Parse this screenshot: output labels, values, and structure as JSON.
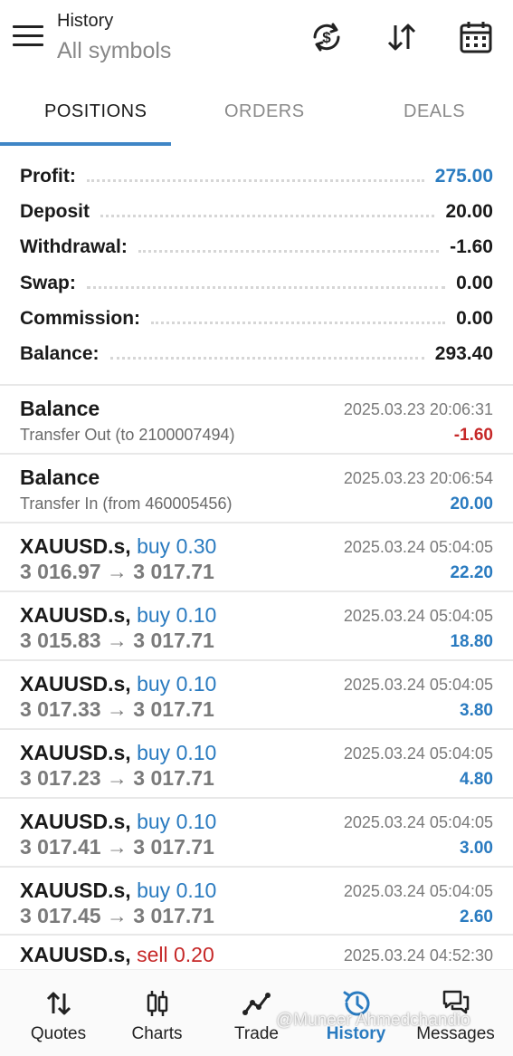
{
  "header": {
    "title": "History",
    "subtitle": "All symbols",
    "icons": [
      "menu-icon",
      "currency-exchange-icon",
      "sort-icon",
      "calendar-icon"
    ]
  },
  "tabs": [
    {
      "label": "POSITIONS",
      "active": true
    },
    {
      "label": "ORDERS",
      "active": false
    },
    {
      "label": "DEALS",
      "active": false
    }
  ],
  "summary": [
    {
      "label": "Profit:",
      "value": "275.00",
      "highlight": true
    },
    {
      "label": "Deposit",
      "value": "20.00",
      "highlight": false
    },
    {
      "label": "Withdrawal:",
      "value": "-1.60",
      "highlight": false
    },
    {
      "label": "Swap:",
      "value": "0.00",
      "highlight": false
    },
    {
      "label": "Commission:",
      "value": "0.00",
      "highlight": false
    },
    {
      "label": "Balance:",
      "value": "293.40",
      "highlight": false
    }
  ],
  "balance_entries": [
    {
      "title": "Balance",
      "detail": "Transfer Out (to 2100007494)",
      "time": "2025.03.23 20:06:31",
      "amount": "-1.60",
      "sign": "neg"
    },
    {
      "title": "Balance",
      "detail": "Transfer In (from 460005456)",
      "time": "2025.03.23 20:06:54",
      "amount": "20.00",
      "sign": "pos"
    }
  ],
  "positions": [
    {
      "symbol": "XAUUSD.s,",
      "side": "buy 0.30",
      "type": "buy",
      "price": "3 016.97 → 3 017.71",
      "time": "2025.03.24 05:04:05",
      "profit": "22.20"
    },
    {
      "symbol": "XAUUSD.s,",
      "side": "buy 0.10",
      "type": "buy",
      "price": "3 015.83 → 3 017.71",
      "time": "2025.03.24 05:04:05",
      "profit": "18.80"
    },
    {
      "symbol": "XAUUSD.s,",
      "side": "buy 0.10",
      "type": "buy",
      "price": "3 017.33 → 3 017.71",
      "time": "2025.03.24 05:04:05",
      "profit": "3.80"
    },
    {
      "symbol": "XAUUSD.s,",
      "side": "buy 0.10",
      "type": "buy",
      "price": "3 017.23 → 3 017.71",
      "time": "2025.03.24 05:04:05",
      "profit": "4.80"
    },
    {
      "symbol": "XAUUSD.s,",
      "side": "buy 0.10",
      "type": "buy",
      "price": "3 017.41 → 3 017.71",
      "time": "2025.03.24 05:04:05",
      "profit": "3.00"
    },
    {
      "symbol": "XAUUSD.s,",
      "side": "buy 0.10",
      "type": "buy",
      "price": "3 017.45 → 3 017.71",
      "time": "2025.03.24 05:04:05",
      "profit": "2.60"
    },
    {
      "symbol": "XAUUSD.s,",
      "side": "sell 0.20",
      "type": "sell",
      "price": "",
      "time": "2025.03.24 04:52:30",
      "profit": ""
    }
  ],
  "bottom_nav": [
    {
      "label": "Quotes",
      "icon": "quotes-icon",
      "active": false
    },
    {
      "label": "Charts",
      "icon": "charts-icon",
      "active": false
    },
    {
      "label": "Trade",
      "icon": "trade-icon",
      "active": false
    },
    {
      "label": "History",
      "icon": "history-icon",
      "active": true
    },
    {
      "label": "Messages",
      "icon": "messages-icon",
      "active": false
    }
  ],
  "watermark": "@Muneer Ahmedchandio",
  "colors": {
    "accent": "#2a7bc0",
    "negative": "#c62828",
    "tab_indicator": "#3f86c6"
  }
}
